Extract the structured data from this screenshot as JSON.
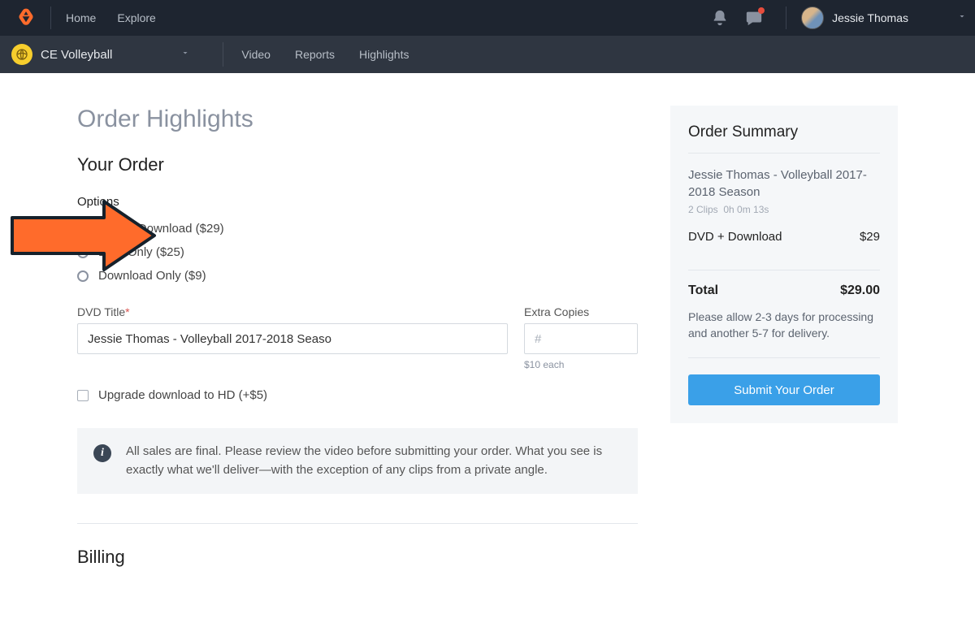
{
  "topbar": {
    "home": "Home",
    "explore": "Explore",
    "user_name": "Jessie Thomas"
  },
  "subbar": {
    "team": "CE Volleyball",
    "links": [
      "Video",
      "Reports",
      "Highlights"
    ]
  },
  "page": {
    "title": "Order Highlights",
    "your_order": "Your Order",
    "billing": "Billing"
  },
  "options": {
    "label": "Options",
    "items": [
      {
        "label": "DVD + Download ($29)",
        "checked": true
      },
      {
        "label": "DVD Only ($25)",
        "checked": false
      },
      {
        "label": "Download Only ($9)",
        "checked": false
      }
    ]
  },
  "fields": {
    "dvd_title_label": "DVD Title",
    "dvd_title_value": "Jessie Thomas - Volleyball 2017-2018 Seaso",
    "extra_copies_label": "Extra Copies",
    "extra_copies_placeholder": "#",
    "extra_hint": "$10 each",
    "upgrade_label": "Upgrade download to HD (+$5)"
  },
  "info": "All sales are final. Please review the video before submitting your order. What you see is exactly what we'll deliver—with the exception of any clips from a private angle.",
  "summary": {
    "title": "Order Summary",
    "name": "Jessie Thomas - Volleyball 2017-2018 Season",
    "clips": "2 Clips",
    "duration": "0h 0m 13s",
    "line_item": "DVD + Download",
    "line_price": "$29",
    "total_label": "Total",
    "total_value": "$29.00",
    "note": "Please allow 2-3 days for processing and another 5-7 for delivery.",
    "submit": "Submit Your Order"
  }
}
